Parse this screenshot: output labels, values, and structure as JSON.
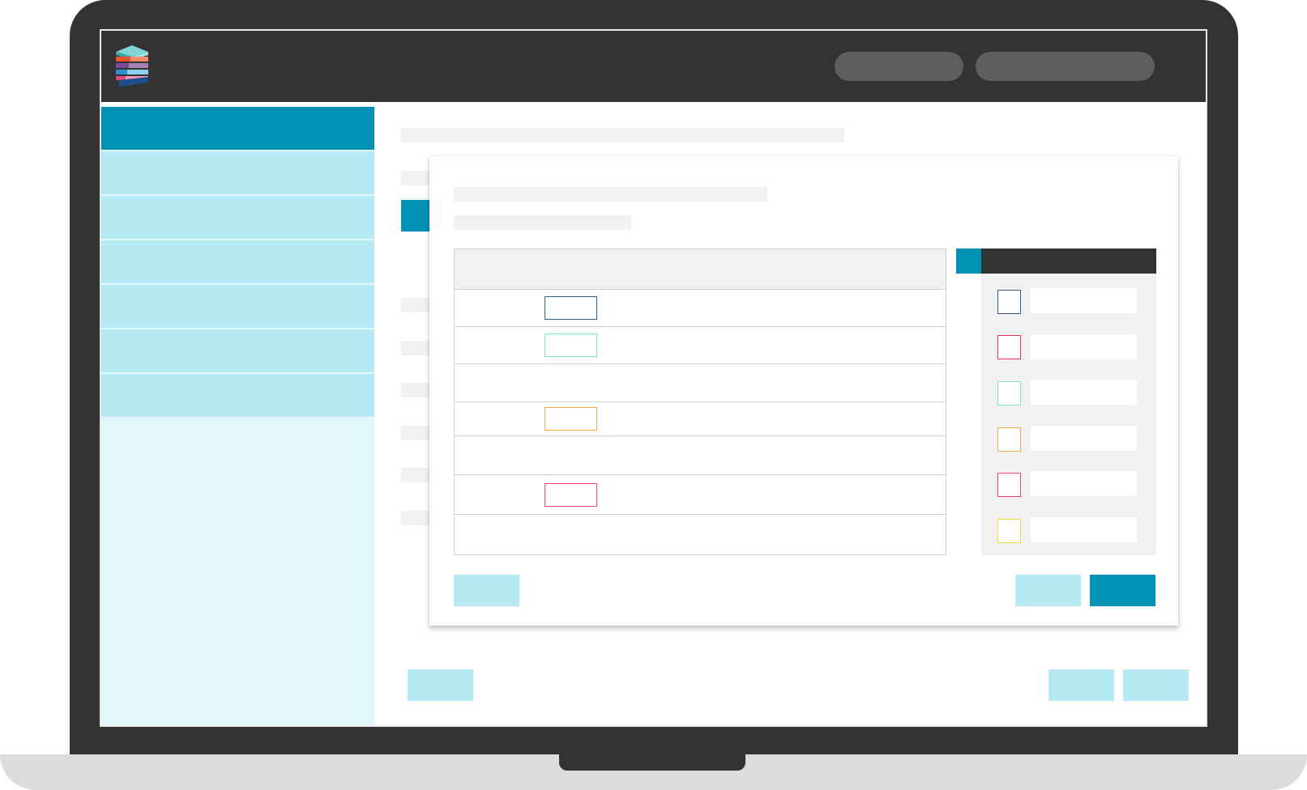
{
  "colors": {
    "bezel": "#333333",
    "base": "#dcdcde",
    "accent": "#0091b3",
    "accent_light": "#b5e9f3",
    "sidebar_bg": "#e2f7fc",
    "placeholder": "#f1f1f1"
  },
  "header": {
    "logo_icon": "stacked-books-logo",
    "pills": [
      {
        "label": ""
      },
      {
        "label": ""
      }
    ]
  },
  "sidebar": {
    "items": [
      {
        "label": "",
        "active": true
      },
      {
        "label": "",
        "active": false
      },
      {
        "label": "",
        "active": false
      },
      {
        "label": "",
        "active": false
      },
      {
        "label": "",
        "active": false
      },
      {
        "label": "",
        "active": false
      },
      {
        "label": "",
        "active": false
      }
    ]
  },
  "modal": {
    "title": "",
    "subtitle": "",
    "table_rows": [
      {
        "tag_color": "#2b5f95"
      },
      {
        "tag_color": "#7fe3cf"
      },
      {
        "tag_color": null
      },
      {
        "tag_color": "#f4a94a"
      },
      {
        "tag_color": null
      },
      {
        "tag_color": "#ea3f88"
      },
      {
        "tag_color": null
      }
    ],
    "legend": [
      {
        "color": "#2b5f95",
        "label": ""
      },
      {
        "color": "#e6334f",
        "label": ""
      },
      {
        "color": "#7fe3cf",
        "label": ""
      },
      {
        "color": "#f4a94a",
        "label": ""
      },
      {
        "color": "#ea3f88",
        "label": ""
      },
      {
        "color": "#f2dc4a",
        "label": ""
      }
    ],
    "buttons": {
      "left": "",
      "secondary": "",
      "primary": ""
    }
  },
  "page_buttons": {
    "left": "",
    "right_a": "",
    "right_b": ""
  }
}
